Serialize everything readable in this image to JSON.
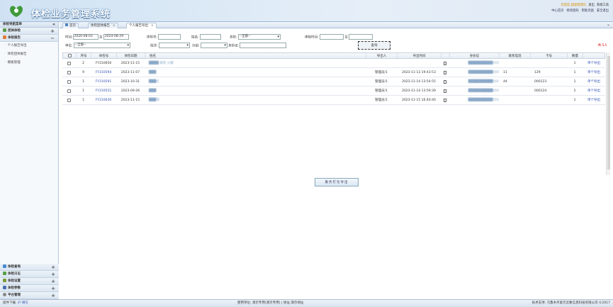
{
  "header": {
    "title": "体检业务管理系统",
    "user_line": [
      "欢迎您,超级管理员",
      "退出",
      "系统工具"
    ],
    "links": [
      "中心首页",
      "修改密码",
      "帮助页面",
      "安全退出"
    ]
  },
  "sidebar": {
    "title": "体检导航菜单",
    "categories": [
      {
        "label": "团体体检",
        "icon": "group-icon",
        "expanded": false
      },
      {
        "label": "体检报告",
        "icon": "report-icon",
        "expanded": true
      }
    ],
    "sub_items": [
      "个人报告导出",
      "体检团体报告",
      "模板管理"
    ],
    "bottom": [
      {
        "label": "体检查询",
        "icon": "query-icon"
      },
      {
        "label": "体检日志",
        "icon": "log-icon"
      },
      {
        "label": "体检设置",
        "icon": "settings-icon"
      },
      {
        "label": "体检参数",
        "icon": "params-icon"
      },
      {
        "label": "平台管理",
        "icon": "gear-icon"
      }
    ]
  },
  "tabs": [
    {
      "label": "首页"
    },
    {
      "label": "体检团体报告"
    },
    {
      "label": "个人报告导出",
      "active": true
    }
  ],
  "filters": {
    "time_label": "时间:",
    "date_from": "2020-08-03",
    "to": "至",
    "date_to": "2024-08-29",
    "num_label": "体检号:",
    "name_label": "姓名:",
    "gen_label": "总检:",
    "gen_value": "--全部--",
    "audit_label": "审核时间:",
    "to2": "至",
    "unit_label": "单位:",
    "unit_value": "--全部--",
    "batch_label": "批次:",
    "group_label": "分组:",
    "id_label": "身份证:",
    "query": "查询",
    "total": "共:5人"
  },
  "columns": [
    "",
    "序号",
    "体检号",
    "体检日期",
    "姓名",
    "",
    "导出人",
    "导出时间",
    "",
    "身份证",
    "联系电话",
    "卡号",
    "数量",
    ""
  ],
  "rows": [
    {
      "seq": "2",
      "num": "FY210650",
      "date": "2023-11-15",
      "name": "████ 郝改 沙睿",
      "exporter": "",
      "time": "",
      "id": "██████████05X",
      "phone": "",
      "card": "",
      "count": "1",
      "act": "单个导出"
    },
    {
      "seq": "9",
      "num": "FY210594",
      "date": "2023-11-07",
      "name": "███",
      "exporter": "管理员/1",
      "time": "2023-11-13 19:43:53",
      "id": "██████████000",
      "phone": "11",
      "card": "129",
      "count": "1",
      "act": "单个导出"
    },
    {
      "seq": "1",
      "num": "FY210591",
      "date": "2023-10-31",
      "name": "███红",
      "exporter": "管理员/1",
      "time": "2023-11-14 13:54:55",
      "id": "██████████000",
      "phone": "44",
      "card": "000123",
      "count": "1",
      "act": "单个导出"
    },
    {
      "seq": "1",
      "num": "FY210551",
      "date": "2023-09-26",
      "name": "███",
      "exporter": "管理员/1",
      "time": "2023-11-14 13:59:39",
      "id": "██████████000",
      "phone": "",
      "card": "000124",
      "count": "2",
      "act": "单个导出"
    },
    {
      "seq": "1",
      "num": "FY210630",
      "date": "2023-11-15",
      "name": "███琴",
      "exporter": "管理员/1",
      "time": "2023-11-15 16:40:40",
      "id": "██████████05X",
      "phone": "",
      "card": "",
      "count": "1",
      "act": "单个导出"
    }
  ],
  "pack_button": "服务打包导出",
  "footer": {
    "left": "提件下载:",
    "left_link": "沪·填写",
    "middle": "使用单位: 演示专用(演示专用) | 地址:演示地址",
    "right": "技术支持: 乌鲁木齐爱元云象信息科技有限公司 ©2017"
  }
}
